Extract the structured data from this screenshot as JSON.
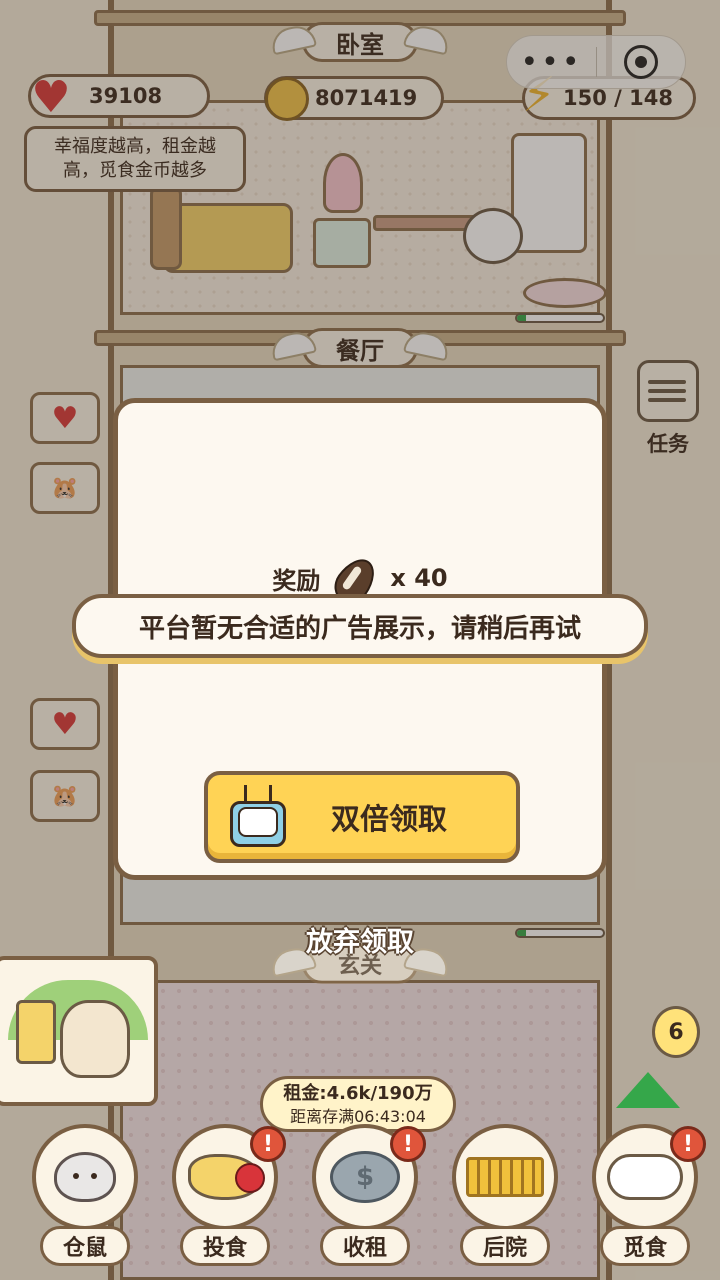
{
  "hud": {
    "happiness": "39108",
    "coins": "8071419",
    "energy": "150 / 148",
    "tooltip_line1": "幸福度越高，租金越",
    "tooltip_line2": "高，觅食金币越多"
  },
  "rooms": {
    "bedroom": "卧室",
    "dining": "餐厅",
    "entry": "玄关"
  },
  "task": {
    "label": "任务"
  },
  "modal": {
    "reward_label": "奖励",
    "reward_amount": "x 40",
    "double_button": "双倍领取"
  },
  "toast": {
    "message": "平台暂无合适的广告展示，请稍后再试"
  },
  "give_up": "放弃领取",
  "notification_count": "6",
  "rent": {
    "line1": "租金:4.6k/190万",
    "line2": "距离存满06:43:04"
  },
  "nav": {
    "items": [
      {
        "label": "仓鼠",
        "alert": ""
      },
      {
        "label": "投食",
        "alert": "!"
      },
      {
        "label": "收租",
        "alert": "!"
      },
      {
        "label": "后院",
        "alert": ""
      },
      {
        "label": "觅食",
        "alert": "!"
      }
    ]
  },
  "icons": {
    "happiness": "heart-icon",
    "coins": "hamster-coin-icon",
    "energy": "lightning-icon",
    "reward": "sunflower-seed-icon",
    "double": "tv-ad-icon"
  },
  "colors": {
    "accent": "#ffd355",
    "border": "#7a5f43",
    "alert": "#e0553b",
    "progress": "#35a74a"
  }
}
